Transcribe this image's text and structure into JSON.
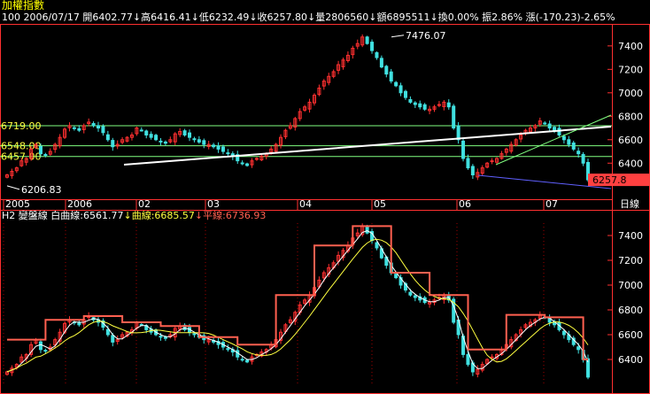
{
  "title": "加權指數",
  "quote_line": {
    "code": "100",
    "date": "2006/07/17",
    "open": "開6402.77",
    "high": "↓高6416.41",
    "low": "↓低6232.49",
    "close": "↓收6257.80",
    "volume": "↓量2806560",
    "amount": "↓額6895511",
    "turnover": "↓換0.00%",
    "amplitude": "振2.86%",
    "change": "漲(-170.23)-2.65%"
  },
  "lower_panel": {
    "id": "H2",
    "name": "變盤線",
    "white_curve": "白曲線:6561.77",
    "yellow_curve": "↓曲線:6685.57",
    "flat_line": "↓平線:6736.93"
  },
  "lower_axis_label": "日線",
  "colors": {
    "up": "#ff3030",
    "down": "#40e0e0",
    "white_curve": "#ffffff",
    "yellow_curve": "#ffff40",
    "flat_line": "#ff6050",
    "level_lines": "#80ff80",
    "channel": "#6060ff",
    "frame": "#ff3030",
    "grid": "#a00000",
    "highlight": "#ff4040"
  },
  "chart_data": [
    {
      "type": "candlestick",
      "panel": "upper",
      "y_ticks": [
        6400,
        6600,
        6800,
        7000,
        7200,
        7400
      ],
      "ylim": [
        6100,
        7580
      ],
      "x_tick_labels": [
        "2005",
        "2006",
        "02",
        "03",
        "04",
        "05",
        "06",
        "07"
      ],
      "annotations": [
        {
          "label": "7476.07",
          "value": 7476.07
        },
        {
          "label": "6206.83",
          "value": 6206.83
        }
      ],
      "levels": [
        {
          "label": "6719.00",
          "value": 6719.0
        },
        {
          "label": "6548.00",
          "value": 6548.0
        },
        {
          "label": "6457.00",
          "value": 6457.0
        }
      ],
      "last_value_label": "6257.8",
      "close_series": [
        6300,
        6330,
        6360,
        6420,
        6440,
        6520,
        6560,
        6480,
        6470,
        6500,
        6560,
        6620,
        6690,
        6720,
        6700,
        6680,
        6720,
        6750,
        6720,
        6700,
        6660,
        6600,
        6540,
        6560,
        6600,
        6620,
        6640,
        6700,
        6680,
        6640,
        6620,
        6600,
        6580,
        6570,
        6600,
        6650,
        6670,
        6640,
        6620,
        6600,
        6580,
        6560,
        6560,
        6540,
        6520,
        6500,
        6480,
        6460,
        6420,
        6400,
        6380,
        6420,
        6440,
        6460,
        6480,
        6520,
        6560,
        6620,
        6680,
        6720,
        6780,
        6840,
        6880,
        6920,
        6980,
        7040,
        7100,
        7140,
        7180,
        7240,
        7280,
        7320,
        7380,
        7420,
        7476,
        7420,
        7360,
        7300,
        7220,
        7160,
        7100,
        7060,
        7000,
        6960,
        6920,
        6900,
        6880,
        6860,
        6860,
        6880,
        6900,
        6920,
        6880,
        6700,
        6600,
        6440,
        6360,
        6300,
        6320,
        6360,
        6400,
        6420,
        6440,
        6480,
        6520,
        6560,
        6600,
        6640,
        6680,
        6700,
        6720,
        6760,
        6740,
        6700,
        6680,
        6640,
        6600,
        6560,
        6520,
        6480,
        6400,
        6257.8
      ]
    },
    {
      "type": "candlestick",
      "panel": "lower",
      "y_ticks": [
        6400,
        6600,
        6800,
        7000,
        7200,
        7400
      ],
      "ylim": [
        6200,
        7500
      ]
    }
  ]
}
